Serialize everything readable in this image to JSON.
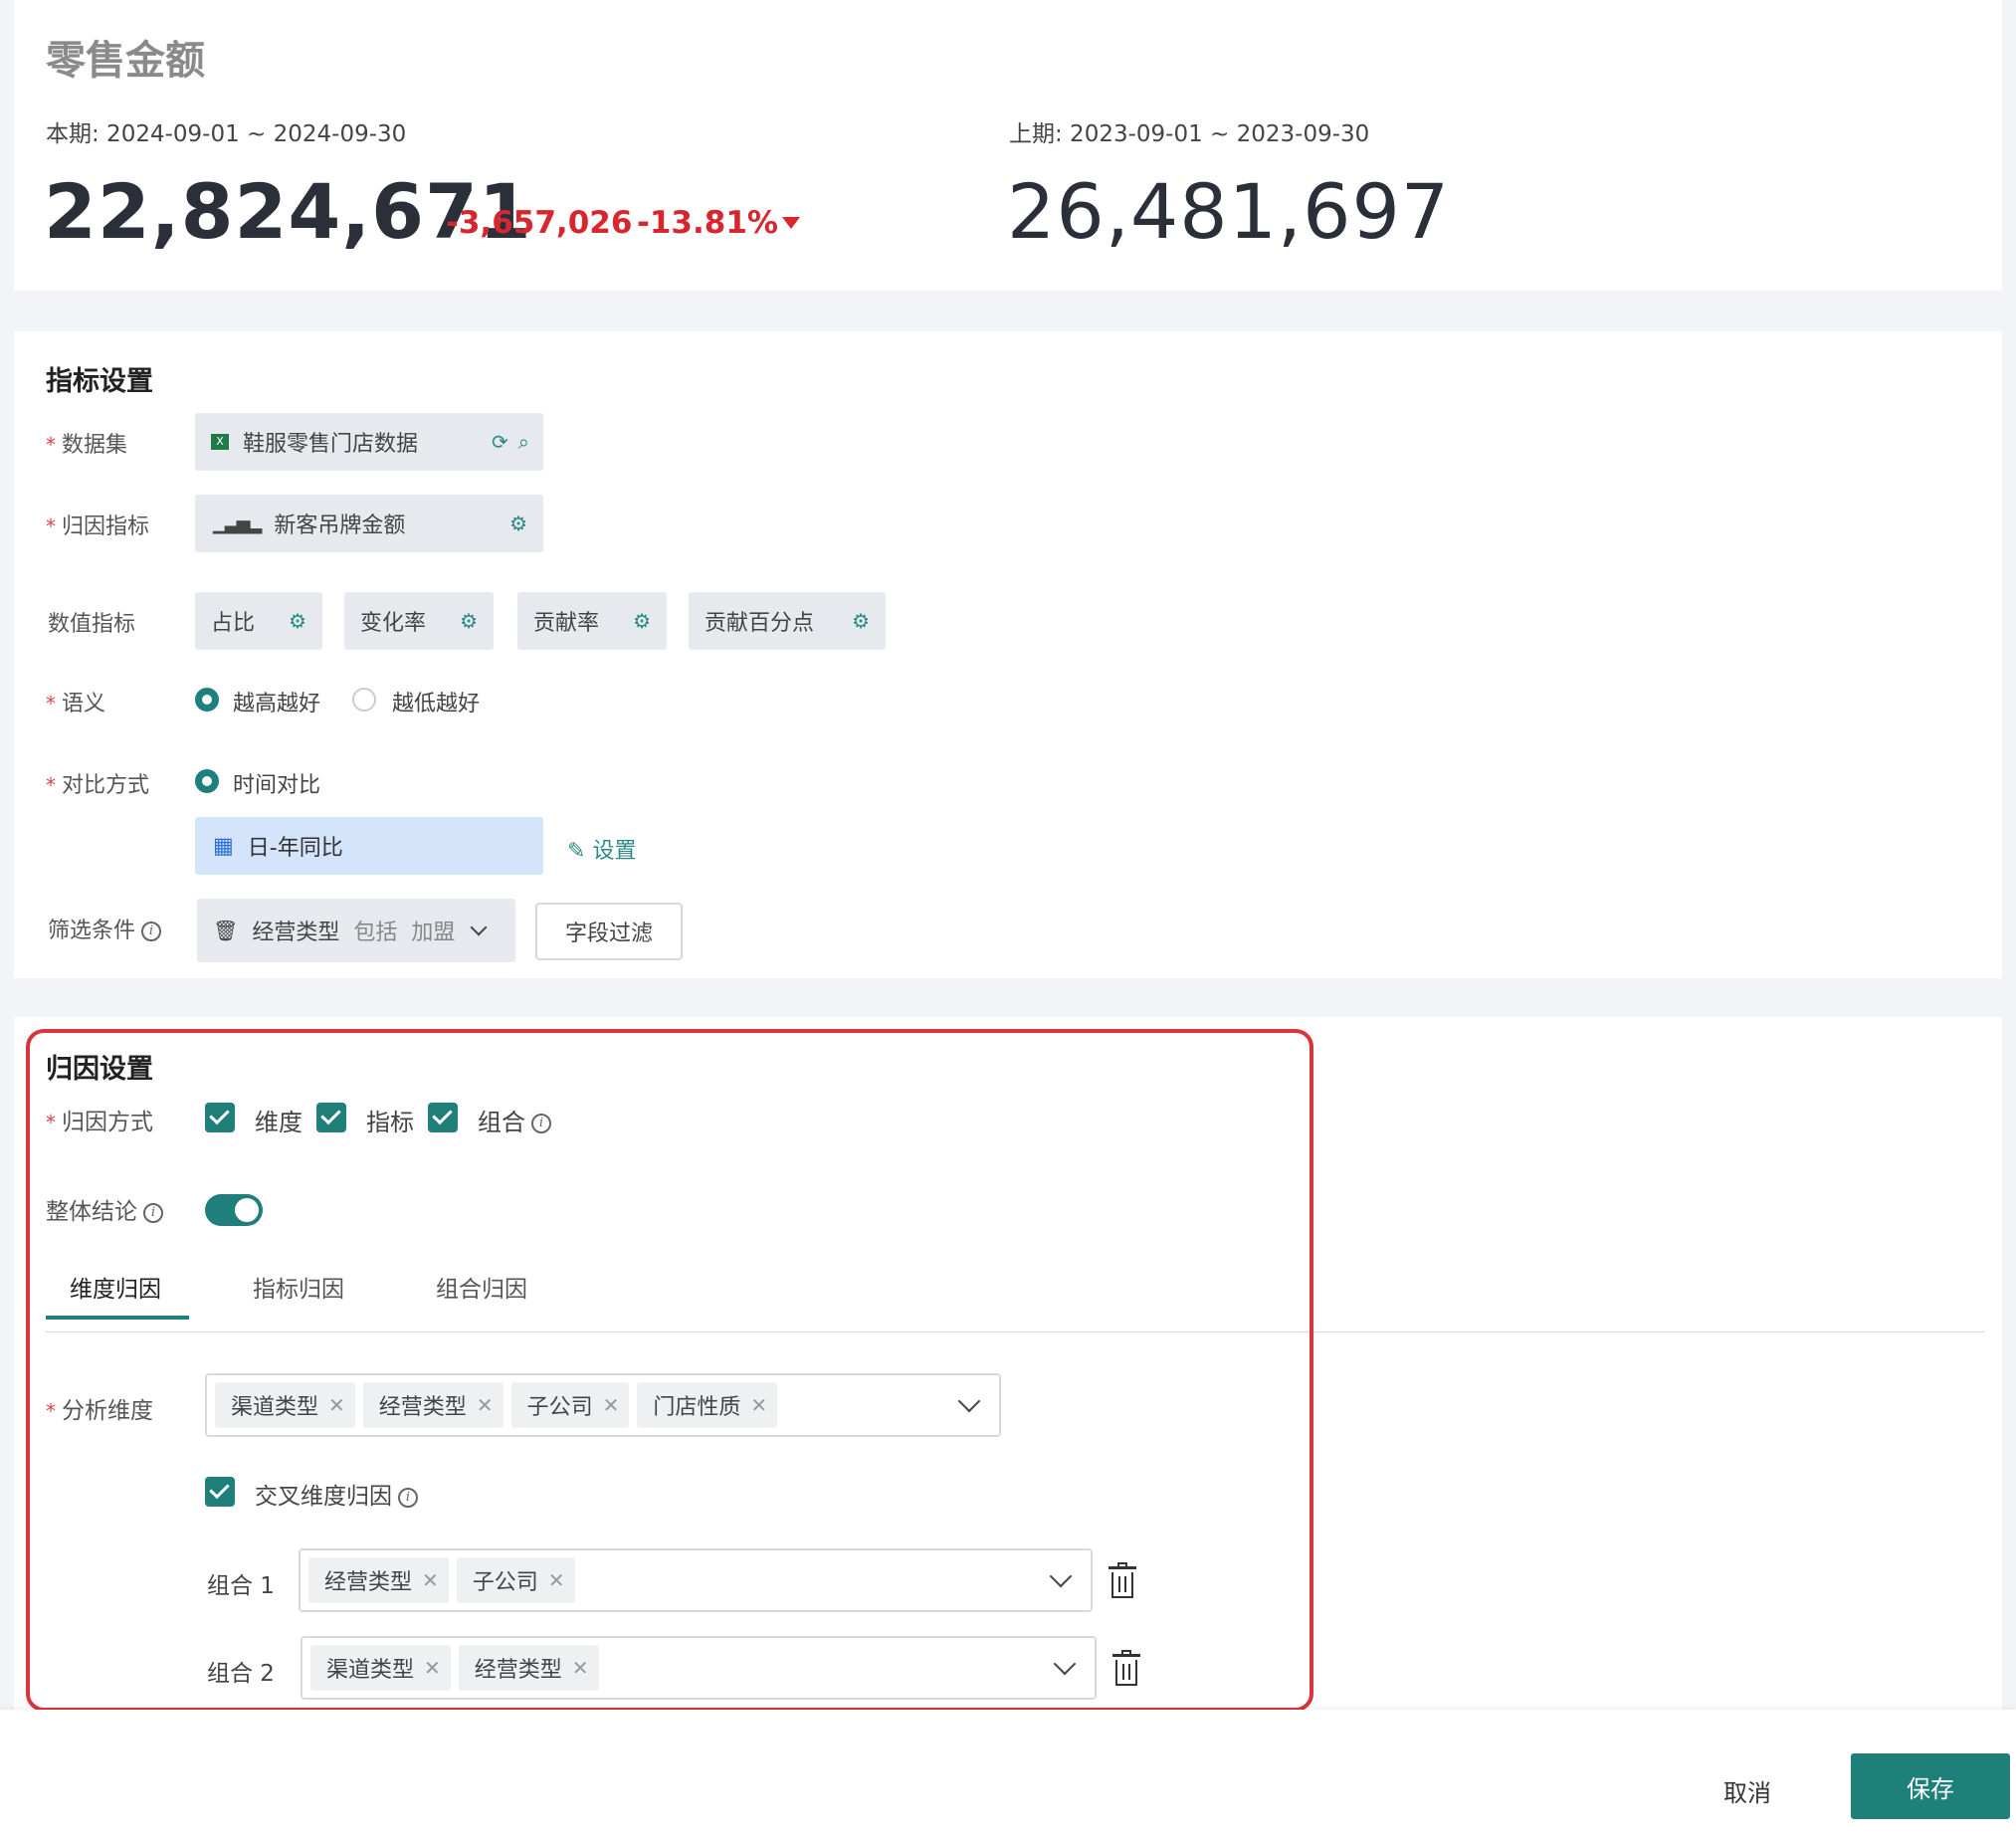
{
  "kpi": {
    "title": "零售金额",
    "current_period": "本期: 2024-09-01 ~ 2024-09-30",
    "previous_period": "上期: 2023-09-01 ~ 2023-09-30",
    "current_value": "22,824,671",
    "diff_value": "-3,657,026",
    "diff_pct": "-13.81%",
    "previous_value": "26,481,697",
    "colors": {
      "negative": "#d8262e"
    }
  },
  "metric_settings": {
    "title": "指标设置",
    "dataset": {
      "label": "数据集",
      "value": "鞋服零售门店数据",
      "icon": "excel-icon",
      "actions": [
        "refresh-icon",
        "preview-icon"
      ]
    },
    "attribution_metric": {
      "label": "归因指标",
      "value": "新客吊牌金额",
      "icon": "bar-chart-icon"
    },
    "numeric_metrics": {
      "label": "数值指标",
      "items": [
        "占比",
        "变化率",
        "贡献率",
        "贡献百分点"
      ]
    },
    "semantic": {
      "label": "语义",
      "options": [
        "越高越好",
        "越低越好"
      ],
      "selected": "越高越好"
    },
    "compare": {
      "label": "对比方式",
      "option": "时间对比",
      "value": "日-年同比",
      "set_label": "设置"
    },
    "filter": {
      "label": "筛选条件",
      "field": "经营类型",
      "op": "包括",
      "value": "加盟",
      "button": "字段过滤"
    }
  },
  "attribution_settings": {
    "title": "归因设置",
    "method": {
      "label": "归因方式",
      "options": [
        "维度",
        "指标",
        "组合"
      ]
    },
    "overall": {
      "label": "整体结论",
      "enabled": true
    },
    "tabs": [
      "维度归因",
      "指标归因",
      "组合归因"
    ],
    "active_tab": "维度归因",
    "dimensions": {
      "label": "分析维度",
      "values": [
        "渠道类型",
        "经营类型",
        "子公司",
        "门店性质"
      ]
    },
    "cross": {
      "label": "交叉维度归因",
      "checked": true
    },
    "combos": [
      {
        "label": "组合 1",
        "values": [
          "经营类型",
          "子公司"
        ]
      },
      {
        "label": "组合 2",
        "values": [
          "渠道类型",
          "经营类型"
        ]
      }
    ],
    "colors": {
      "primary": "#1f7f7b",
      "highlight": "#d9353a"
    }
  },
  "footer": {
    "cancel": "取消",
    "save": "保存"
  }
}
